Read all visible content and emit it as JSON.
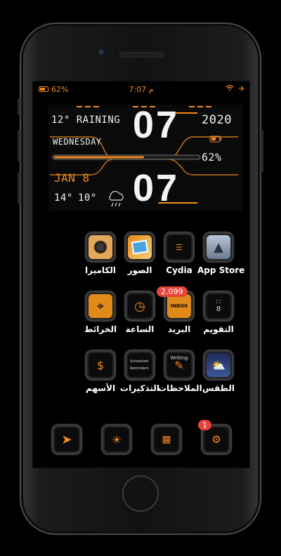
{
  "status_bar": {
    "battery": "62%",
    "time": "7:07 م",
    "icons": [
      "wifi-icon",
      "airplane-icon"
    ]
  },
  "widget": {
    "temp_condition": "12° RAINING",
    "year": "2020",
    "weekday": "WEDNESDAY",
    "hour": "07",
    "minute": "07",
    "battery": "62%",
    "date": "JAN 8",
    "high": "14°",
    "low": "10°"
  },
  "apps": [
    {
      "label": "App Store",
      "icon": "appstore-icon"
    },
    {
      "label": "Cydia",
      "icon": "cydia-icon"
    },
    {
      "label": "الصور",
      "icon": "photos-icon"
    },
    {
      "label": "الكاميرا",
      "icon": "camera-icon"
    },
    {
      "label": "التقويم",
      "icon": "calendar-icon"
    },
    {
      "label": "البريد",
      "icon": "mail-icon",
      "badge": "2.099"
    },
    {
      "label": "الساعة",
      "icon": "clock-icon"
    },
    {
      "label": "الخرائط",
      "icon": "maps-icon"
    },
    {
      "label": "الطقس",
      "icon": "weather-icon"
    },
    {
      "label": "الملاحظات",
      "icon": "notes-icon"
    },
    {
      "label": "التذكيرات",
      "icon": "reminders-icon"
    },
    {
      "label": "الأسهم",
      "icon": "stocks-icon"
    }
  ],
  "mail_inbox": "INBOX",
  "reminders_lines": [
    "Scheduled",
    "Reminders"
  ],
  "notes_title": "Writing",
  "dock": [
    {
      "icon": "telegram-icon"
    },
    {
      "icon": "phoenix-icon"
    },
    {
      "icon": "calculator-icon"
    },
    {
      "icon": "settings-icon",
      "badge": "1"
    }
  ],
  "colors": {
    "accent": "#f08a1e",
    "badge": "#e8433a"
  }
}
